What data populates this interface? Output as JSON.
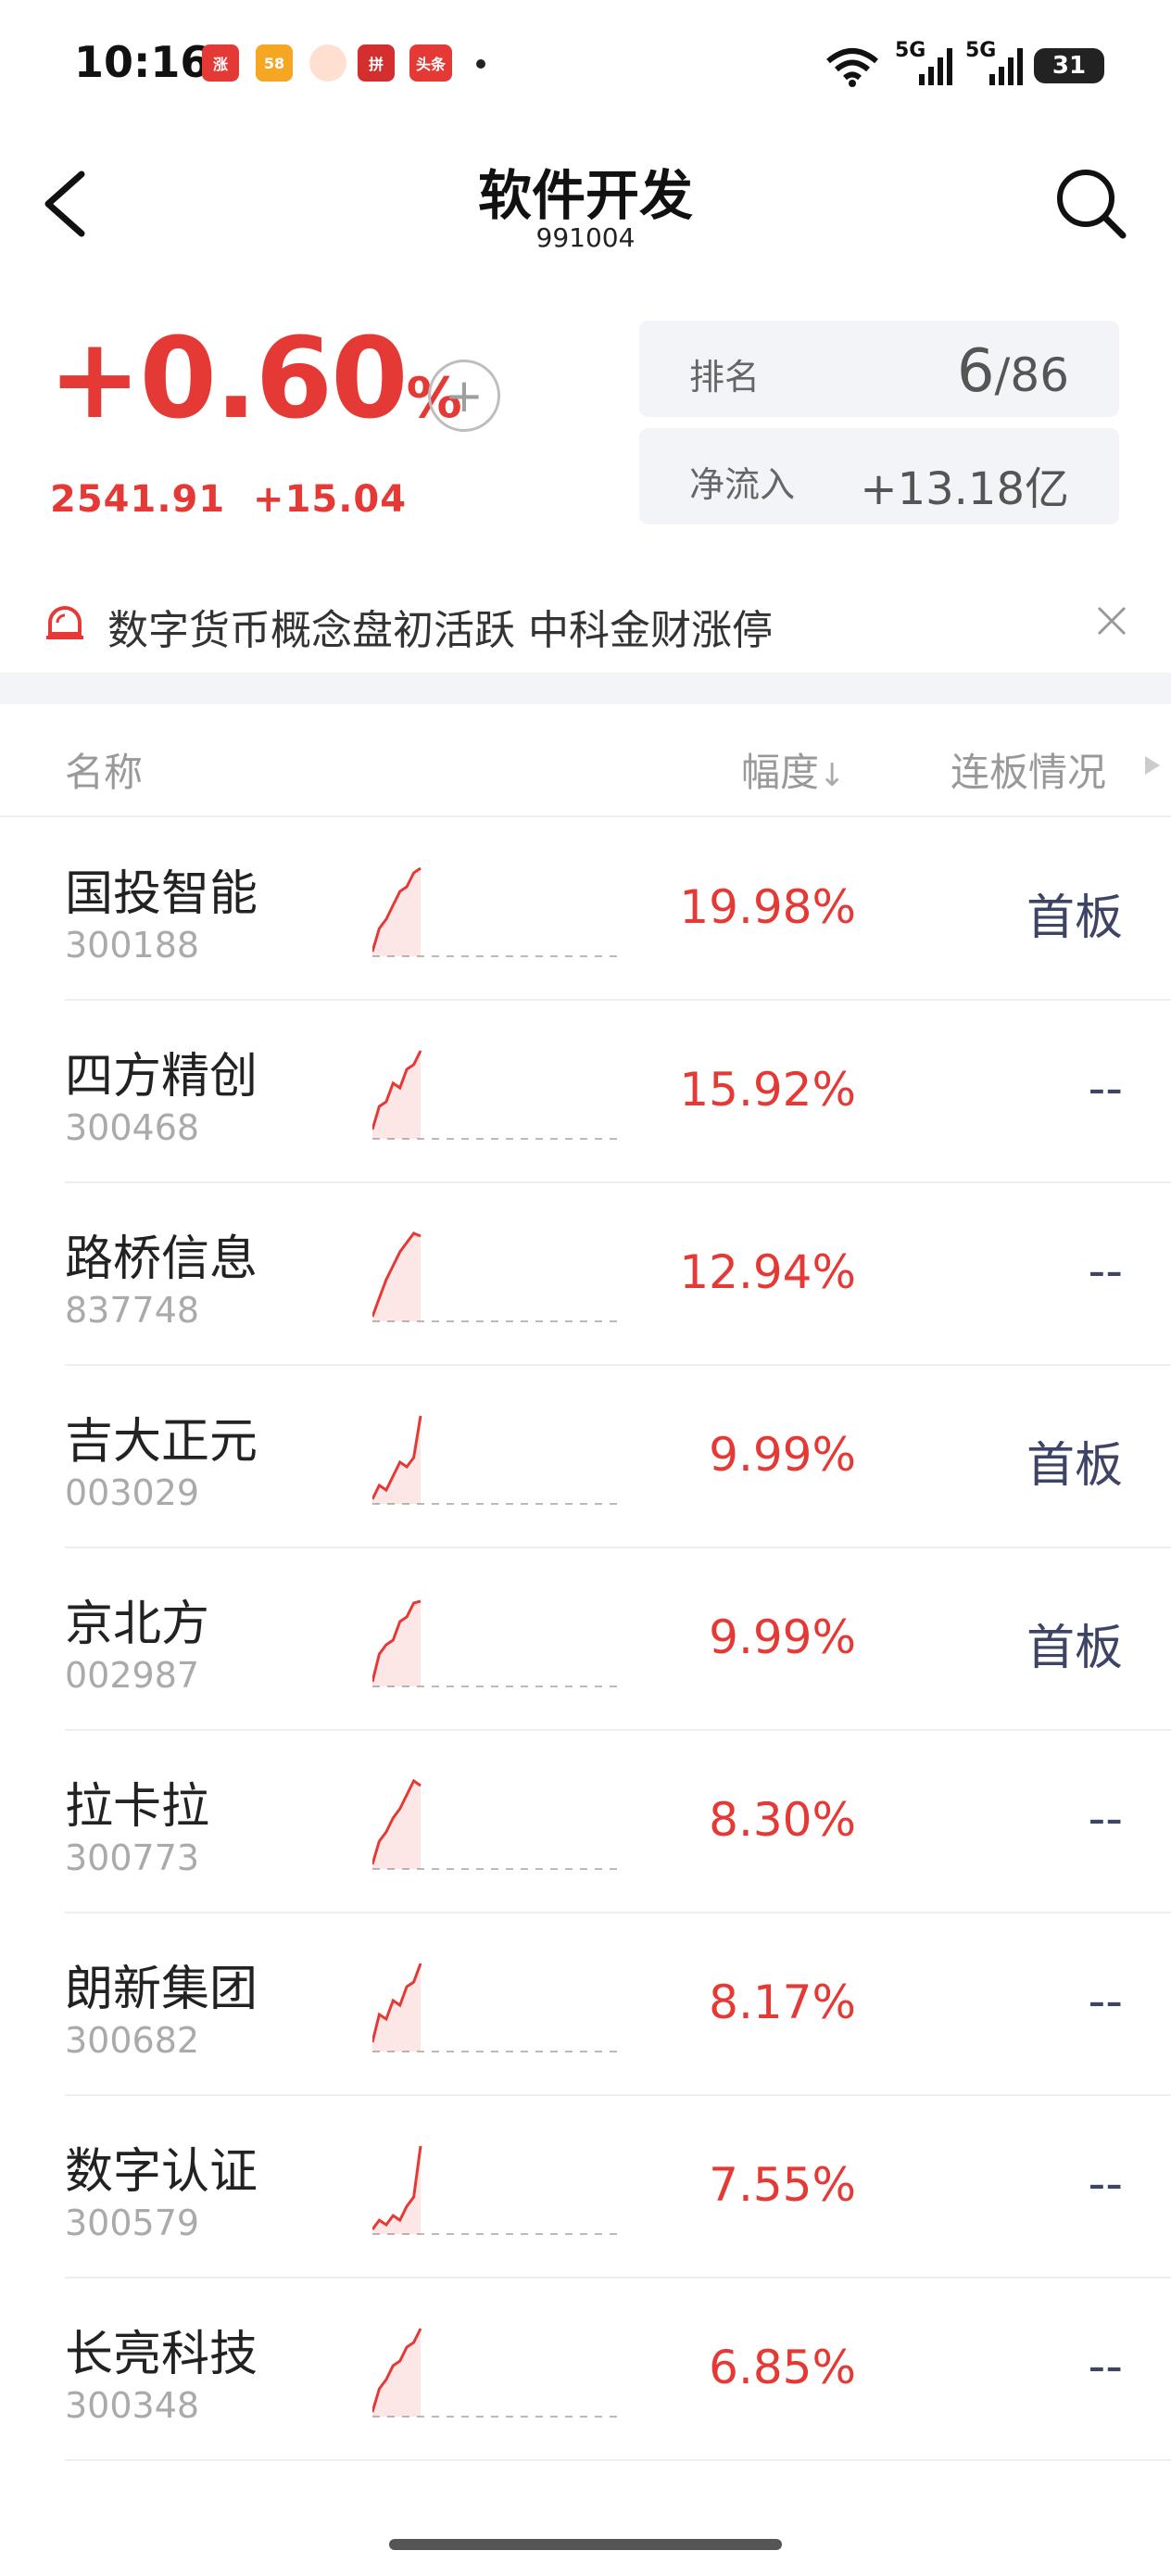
{
  "status_bar": {
    "time": "10:16",
    "network_1": "5G",
    "network_2": "5G",
    "battery": "31"
  },
  "header": {
    "title": "软件开发",
    "code": "991004"
  },
  "summary": {
    "change_pct": "+0.60",
    "change_pct_sign": "%",
    "index_value": "2541.91",
    "index_change": "+15.04",
    "rank_label": "排名",
    "rank_value": "6",
    "rank_total": "/86",
    "net_inflow_label": "净流入",
    "net_inflow_value": "+13.18亿"
  },
  "news": {
    "text": "数字货币概念盘初活跃 中科金财涨停"
  },
  "table": {
    "col_name": "名称",
    "col_change": "幅度",
    "col_board": "连板情况",
    "rows": [
      {
        "name": "国投智能",
        "code": "300188",
        "pct": "19.98%",
        "board": "首板",
        "spark": [
          0.05,
          0.3,
          0.4,
          0.55,
          0.7,
          0.75,
          0.9,
          0.95
        ]
      },
      {
        "name": "四方精创",
        "code": "300468",
        "pct": "15.92%",
        "board": "--",
        "spark": [
          0.1,
          0.35,
          0.4,
          0.6,
          0.55,
          0.75,
          0.8,
          0.95
        ]
      },
      {
        "name": "路桥信息",
        "code": "837748",
        "pct": "12.94%",
        "board": "--",
        "spark": [
          0.05,
          0.25,
          0.45,
          0.6,
          0.75,
          0.85,
          0.95,
          0.92
        ]
      },
      {
        "name": "吉大正元",
        "code": "003029",
        "pct": "9.99%",
        "board": "首板",
        "spark": [
          0.05,
          0.2,
          0.15,
          0.3,
          0.45,
          0.4,
          0.5,
          0.95
        ]
      },
      {
        "name": "京北方",
        "code": "002987",
        "pct": "9.99%",
        "board": "首板",
        "spark": [
          0.05,
          0.35,
          0.45,
          0.5,
          0.7,
          0.75,
          0.9,
          0.92
        ]
      },
      {
        "name": "拉卡拉",
        "code": "300773",
        "pct": "8.30%",
        "board": "--",
        "spark": [
          0.05,
          0.3,
          0.4,
          0.55,
          0.65,
          0.8,
          0.95,
          0.9
        ]
      },
      {
        "name": "朗新集团",
        "code": "300682",
        "pct": "8.17%",
        "board": "--",
        "spark": [
          0.1,
          0.4,
          0.35,
          0.55,
          0.5,
          0.7,
          0.75,
          0.95
        ]
      },
      {
        "name": "数字认证",
        "code": "300579",
        "pct": "7.55%",
        "board": "--",
        "spark": [
          0.05,
          0.15,
          0.1,
          0.2,
          0.15,
          0.3,
          0.4,
          0.95
        ]
      },
      {
        "name": "长亮科技",
        "code": "300348",
        "pct": "6.85%",
        "board": "--",
        "spark": [
          0.05,
          0.3,
          0.4,
          0.55,
          0.6,
          0.75,
          0.8,
          0.95
        ]
      }
    ]
  },
  "colors": {
    "up_red": "#e53935",
    "board_text": "#3d4466",
    "muted_gray": "#999999"
  }
}
